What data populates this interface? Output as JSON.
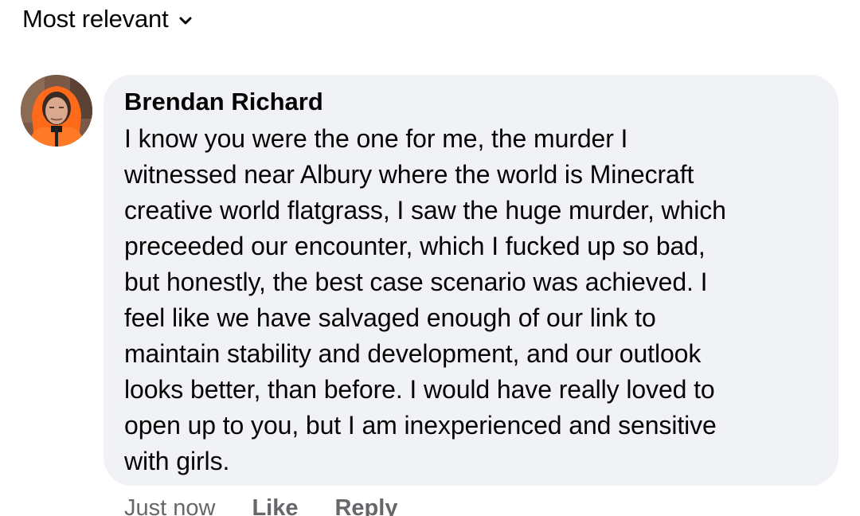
{
  "sort": {
    "label": "Most relevant",
    "icon": "chevron-down-icon"
  },
  "comment": {
    "author": "Brendan Richard",
    "text": "I know you were the one for me, the murder I\nwitnessed near Albury where the world is Minecraft\ncreative world flatgrass, I saw the huge murder, which\npreceeded our encounter, which I fucked up so bad,\nbut honestly, the best case scenario was achieved. I\nfeel like we have salvaged enough of our link to\nmaintain stability and development, and our outlook\nlooks better, than before. I would have really loved to\nopen up to you, but I am inexperienced and sensitive\nwith girls.",
    "avatar_icon": "profile-photo-orange-hood",
    "timestamp": "Just now",
    "like_label": "Like",
    "reply_label": "Reply"
  },
  "colors": {
    "bubble": "#f0f2f5",
    "text": "#050505",
    "secondary": "#65676b",
    "hood": "#ff6a1a"
  }
}
